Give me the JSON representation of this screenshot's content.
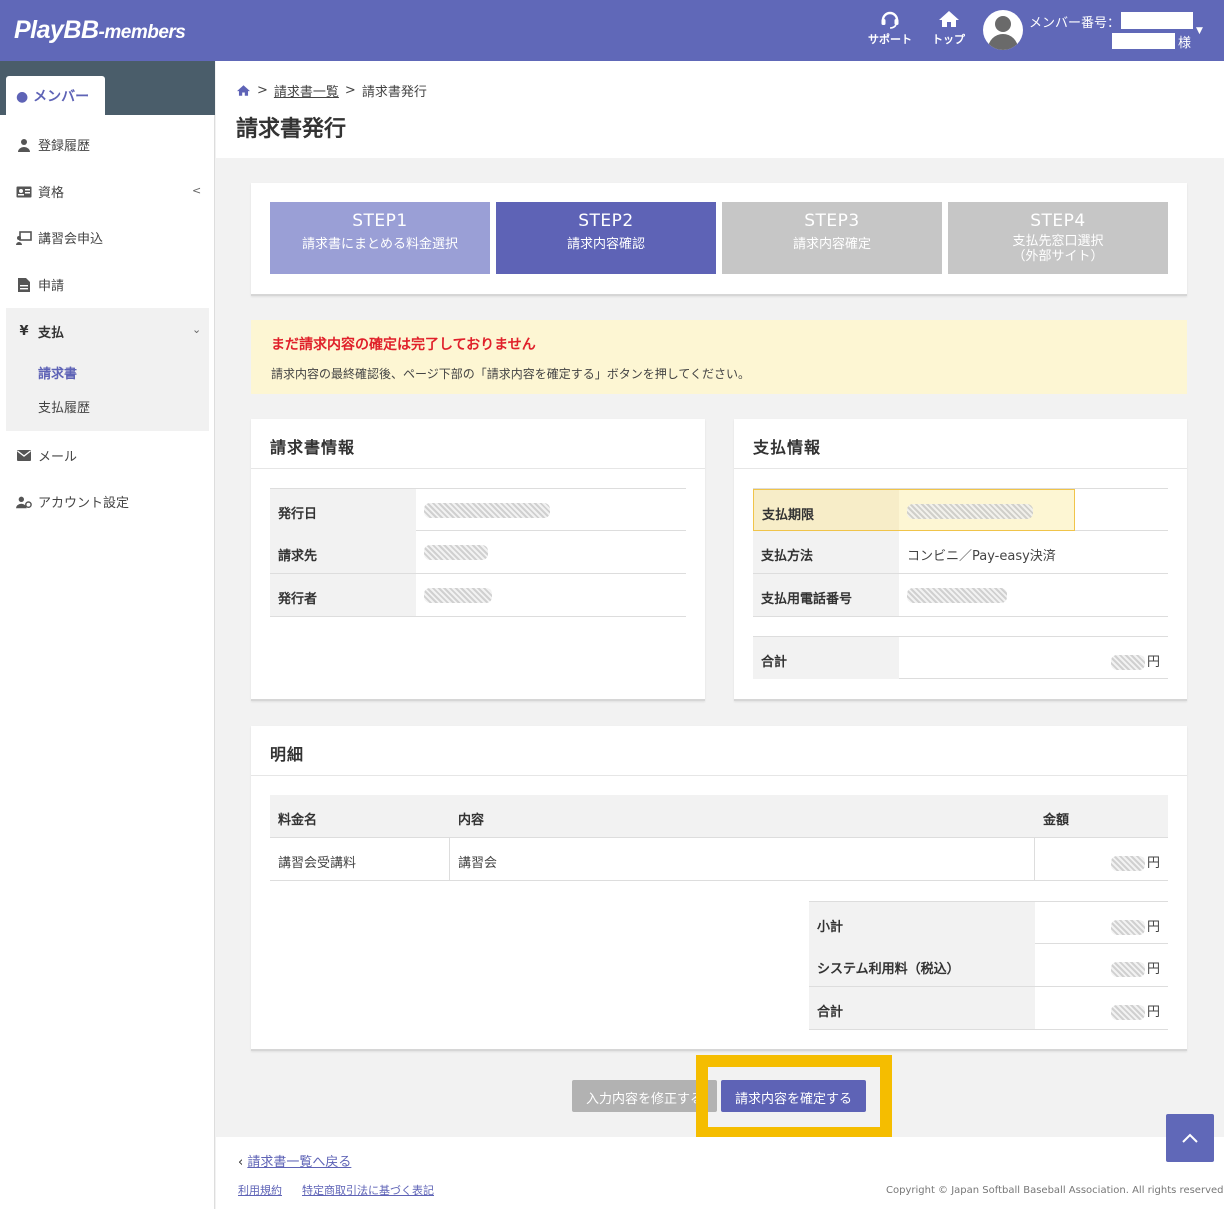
{
  "header": {
    "logo_main": "PlayBB",
    "logo_sub": "-members",
    "support_label": "サポート",
    "top_label": "トップ",
    "member_label": "メンバー番号：",
    "suffix": "様",
    "bg_color": "#6068b8"
  },
  "sidebar": {
    "tab": "メンバー",
    "items": {
      "history": "登録履歴",
      "qualification": "資格",
      "course": "講習会申込",
      "application": "申請",
      "payment": "支払",
      "mail": "メール",
      "account": "アカウント設定"
    },
    "payment_sub": {
      "invoice": "請求書",
      "history": "支払履歴"
    }
  },
  "breadcrumb": {
    "list": "請求書一覧",
    "current": "請求書発行"
  },
  "page_title": "請求書発行",
  "steps": [
    {
      "num": "STEP1",
      "desc": "請求書にまとめる料金選択",
      "state": "done"
    },
    {
      "num": "STEP2",
      "desc": "請求内容確認",
      "state": "active"
    },
    {
      "num": "STEP3",
      "desc": "請求内容確定",
      "state": "todo"
    },
    {
      "num": "STEP4",
      "desc_line1": "支払先窓口選択",
      "desc_line2": "（外部サイト）",
      "state": "todo"
    }
  ],
  "alert": {
    "title": "まだ請求内容の確定は完了しておりません",
    "message": "請求内容の最終確認後、ページ下部の「請求内容を確定する」ボタンを押してください。"
  },
  "invoice_info": {
    "title": "請求書情報",
    "rows": {
      "issue_date": "発行日",
      "billing_to": "請求先",
      "issuer": "発行者"
    }
  },
  "payment_info": {
    "title": "支払情報",
    "rows": {
      "deadline": "支払期限",
      "method": "支払方法",
      "method_value": "コンビニ／Pay-easy決済",
      "phone": "支払用電話番号",
      "total": "合計"
    }
  },
  "details": {
    "title": "明細",
    "columns": {
      "name": "料金名",
      "content": "内容",
      "amount": "金額"
    },
    "items": [
      {
        "name": "講習会受講料",
        "content": "講習会"
      }
    ],
    "summary": {
      "subtotal": "小計",
      "system_fee": "システム利用料（税込）",
      "total": "合計"
    },
    "currency": "円"
  },
  "buttons": {
    "edit": "入力内容を修正する",
    "confirm": "請求内容を確定する"
  },
  "footer": {
    "back": "請求書一覧へ戻る",
    "terms": "利用規約",
    "law": "特定商取引法に基づく表記",
    "copyright": "Copyright © Japan Softball Baseball Association. All rights reserved."
  }
}
